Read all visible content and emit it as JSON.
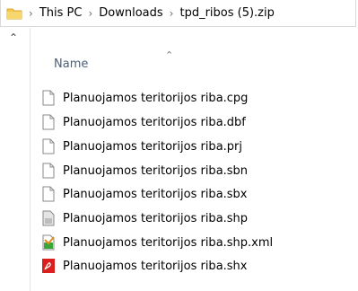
{
  "address_bar": {
    "icon": "folder-icon",
    "breadcrumbs": [
      "This PC",
      "Downloads",
      "tpd_ribos (5).zip"
    ]
  },
  "nav_pane": {
    "collapse_icon": "chevron-up-icon"
  },
  "list": {
    "column_header": "Name",
    "sort_icon": "sort-ascending-icon",
    "files": [
      {
        "name": "Planuojamos teritorijos riba.cpg",
        "icon": "generic-file-icon"
      },
      {
        "name": "Planuojamos teritorijos riba.dbf",
        "icon": "generic-file-icon"
      },
      {
        "name": "Planuojamos teritorijos riba.prj",
        "icon": "generic-file-icon"
      },
      {
        "name": "Planuojamos teritorijos riba.sbn",
        "icon": "generic-file-icon"
      },
      {
        "name": "Planuojamos teritorijos riba.sbx",
        "icon": "generic-file-icon"
      },
      {
        "name": "Planuojamos teritorijos riba.shp",
        "icon": "shapefile-icon"
      },
      {
        "name": "Planuojamos teritorijos riba.shp.xml",
        "icon": "xml-file-icon"
      },
      {
        "name": "Planuojamos teritorijos riba.shx",
        "icon": "pdf-red-icon"
      }
    ]
  },
  "colors": {
    "header_text": "#4c607a",
    "folder_yellow": "#f3c94b",
    "shx_red": "#d9201f",
    "xml_green": "#3aa53a"
  }
}
